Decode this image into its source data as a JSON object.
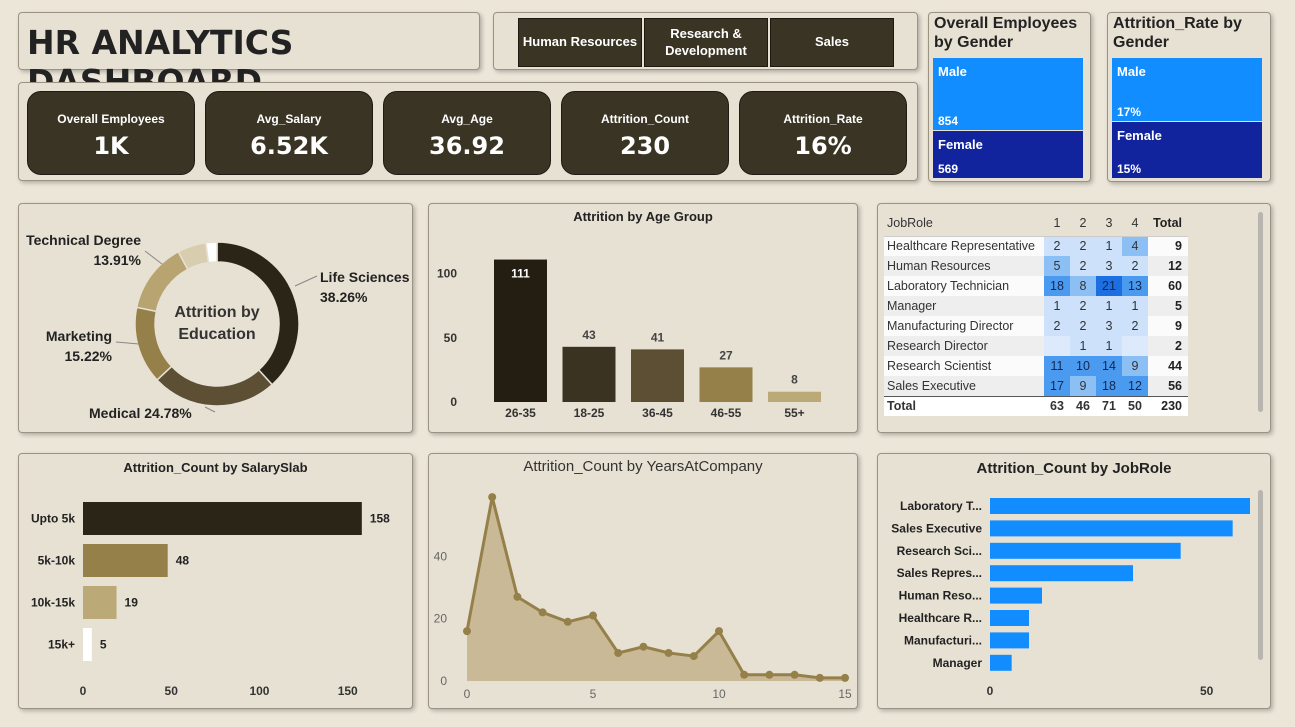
{
  "header": {
    "title": "HR ANALYTICS DASHBOARD"
  },
  "slicer": {
    "items": [
      "Human Resources",
      "Research & Development",
      "Sales"
    ]
  },
  "kpis": [
    {
      "label": "Overall Employees",
      "value": "1K"
    },
    {
      "label": "Avg_Salary",
      "value": "6.52K"
    },
    {
      "label": "Avg_Age",
      "value": "36.92"
    },
    {
      "label": "Attrition_Count",
      "value": "230"
    },
    {
      "label": "Attrition_Rate",
      "value": "16%"
    }
  ],
  "gender_employees": {
    "title": "Overall Employees by Gender",
    "tiles": [
      {
        "label": "Male",
        "value": "854",
        "color": "#118dff"
      },
      {
        "label": "Female",
        "value": "569",
        "color": "#12239e"
      }
    ]
  },
  "gender_rate": {
    "title": "Attrition_Rate by Gender",
    "tiles": [
      {
        "label": "Male",
        "value": "17%",
        "color": "#118dff"
      },
      {
        "label": "Female",
        "value": "15%",
        "color": "#12239e"
      }
    ]
  },
  "chart_data": [
    {
      "type": "pie",
      "variant": "donut",
      "center_label": "Attrition by Education",
      "slices": [
        {
          "label": "Life Sciences",
          "percent": "38.26%",
          "value": 38.26,
          "color": "#2b2517"
        },
        {
          "label": "Medical",
          "percent": "24.78%",
          "value": 24.78,
          "color": "#5c4f33"
        },
        {
          "label": "Marketing",
          "percent": "15.22%",
          "value": 15.22,
          "color": "#958049"
        },
        {
          "label": "Technical Degree",
          "percent": "13.91%",
          "value": 13.91,
          "color": "#b8a470"
        },
        {
          "label": "",
          "percent": "",
          "value": 5.65,
          "color": "#d8cdae"
        },
        {
          "label": "",
          "percent": "",
          "value": 2.18,
          "color": "#ffffff"
        }
      ]
    },
    {
      "type": "bar",
      "title": "Attrition by Age Group",
      "categories": [
        "26-35",
        "18-25",
        "36-45",
        "46-55",
        "55+"
      ],
      "values": [
        111,
        43,
        41,
        27,
        8
      ],
      "colors": [
        "#231e11",
        "#3a3321",
        "#5c4f33",
        "#958049",
        "#bca978"
      ],
      "yticks": [
        0,
        50,
        100
      ],
      "ylim": [
        0,
        120
      ]
    },
    {
      "type": "table",
      "columns": [
        "JobRole",
        "1",
        "2",
        "3",
        "4",
        "Total"
      ],
      "rows": [
        [
          "Healthcare Representative",
          "2",
          "2",
          "1",
          "4",
          "9"
        ],
        [
          "Human Resources",
          "5",
          "2",
          "3",
          "2",
          "12"
        ],
        [
          "Laboratory Technician",
          "18",
          "8",
          "21",
          "13",
          "60"
        ],
        [
          "Manager",
          "1",
          "2",
          "1",
          "1",
          "5"
        ],
        [
          "Manufacturing Director",
          "2",
          "2",
          "3",
          "2",
          "9"
        ],
        [
          "Research Director",
          "",
          "1",
          "1",
          "",
          "2"
        ],
        [
          "Research Scientist",
          "11",
          "10",
          "14",
          "9",
          "44"
        ],
        [
          "Sales Executive",
          "17",
          "9",
          "18",
          "12",
          "56"
        ]
      ],
      "total": [
        "Total",
        "63",
        "46",
        "71",
        "50",
        "230"
      ]
    },
    {
      "type": "bar",
      "orientation": "horizontal",
      "title": "Attrition_Count by SalarySlab",
      "categories": [
        "Upto 5k",
        "5k-10k",
        "10k-15k",
        "15k+"
      ],
      "values": [
        158,
        48,
        19,
        5
      ],
      "colors": [
        "#2b2517",
        "#958049",
        "#bca978",
        "#ffffff"
      ],
      "xticks": [
        0,
        50,
        100,
        150
      ]
    },
    {
      "type": "area",
      "title": "Attrition_Count by YearsAtCompany",
      "x": [
        0,
        1,
        2,
        3,
        4,
        5,
        6,
        7,
        8,
        9,
        10,
        11,
        12,
        13,
        14,
        15
      ],
      "y": [
        16,
        59,
        27,
        22,
        19,
        21,
        9,
        11,
        9,
        8,
        16,
        2,
        2,
        2,
        1,
        1
      ],
      "xticks": [
        0,
        5,
        10,
        15
      ],
      "yticks": [
        0,
        20,
        40
      ],
      "color": "#958049"
    },
    {
      "type": "bar",
      "orientation": "horizontal",
      "title": "Attrition_Count by JobRole",
      "categories": [
        "Laboratory T...",
        "Sales Executive",
        "Research Sci...",
        "Sales Repres...",
        "Human Reso...",
        "Healthcare R...",
        "Manufacturi...",
        "Manager"
      ],
      "values": [
        60,
        56,
        44,
        33,
        12,
        9,
        9,
        5
      ],
      "xticks": [
        0,
        50
      ],
      "color": "#118dff"
    }
  ]
}
